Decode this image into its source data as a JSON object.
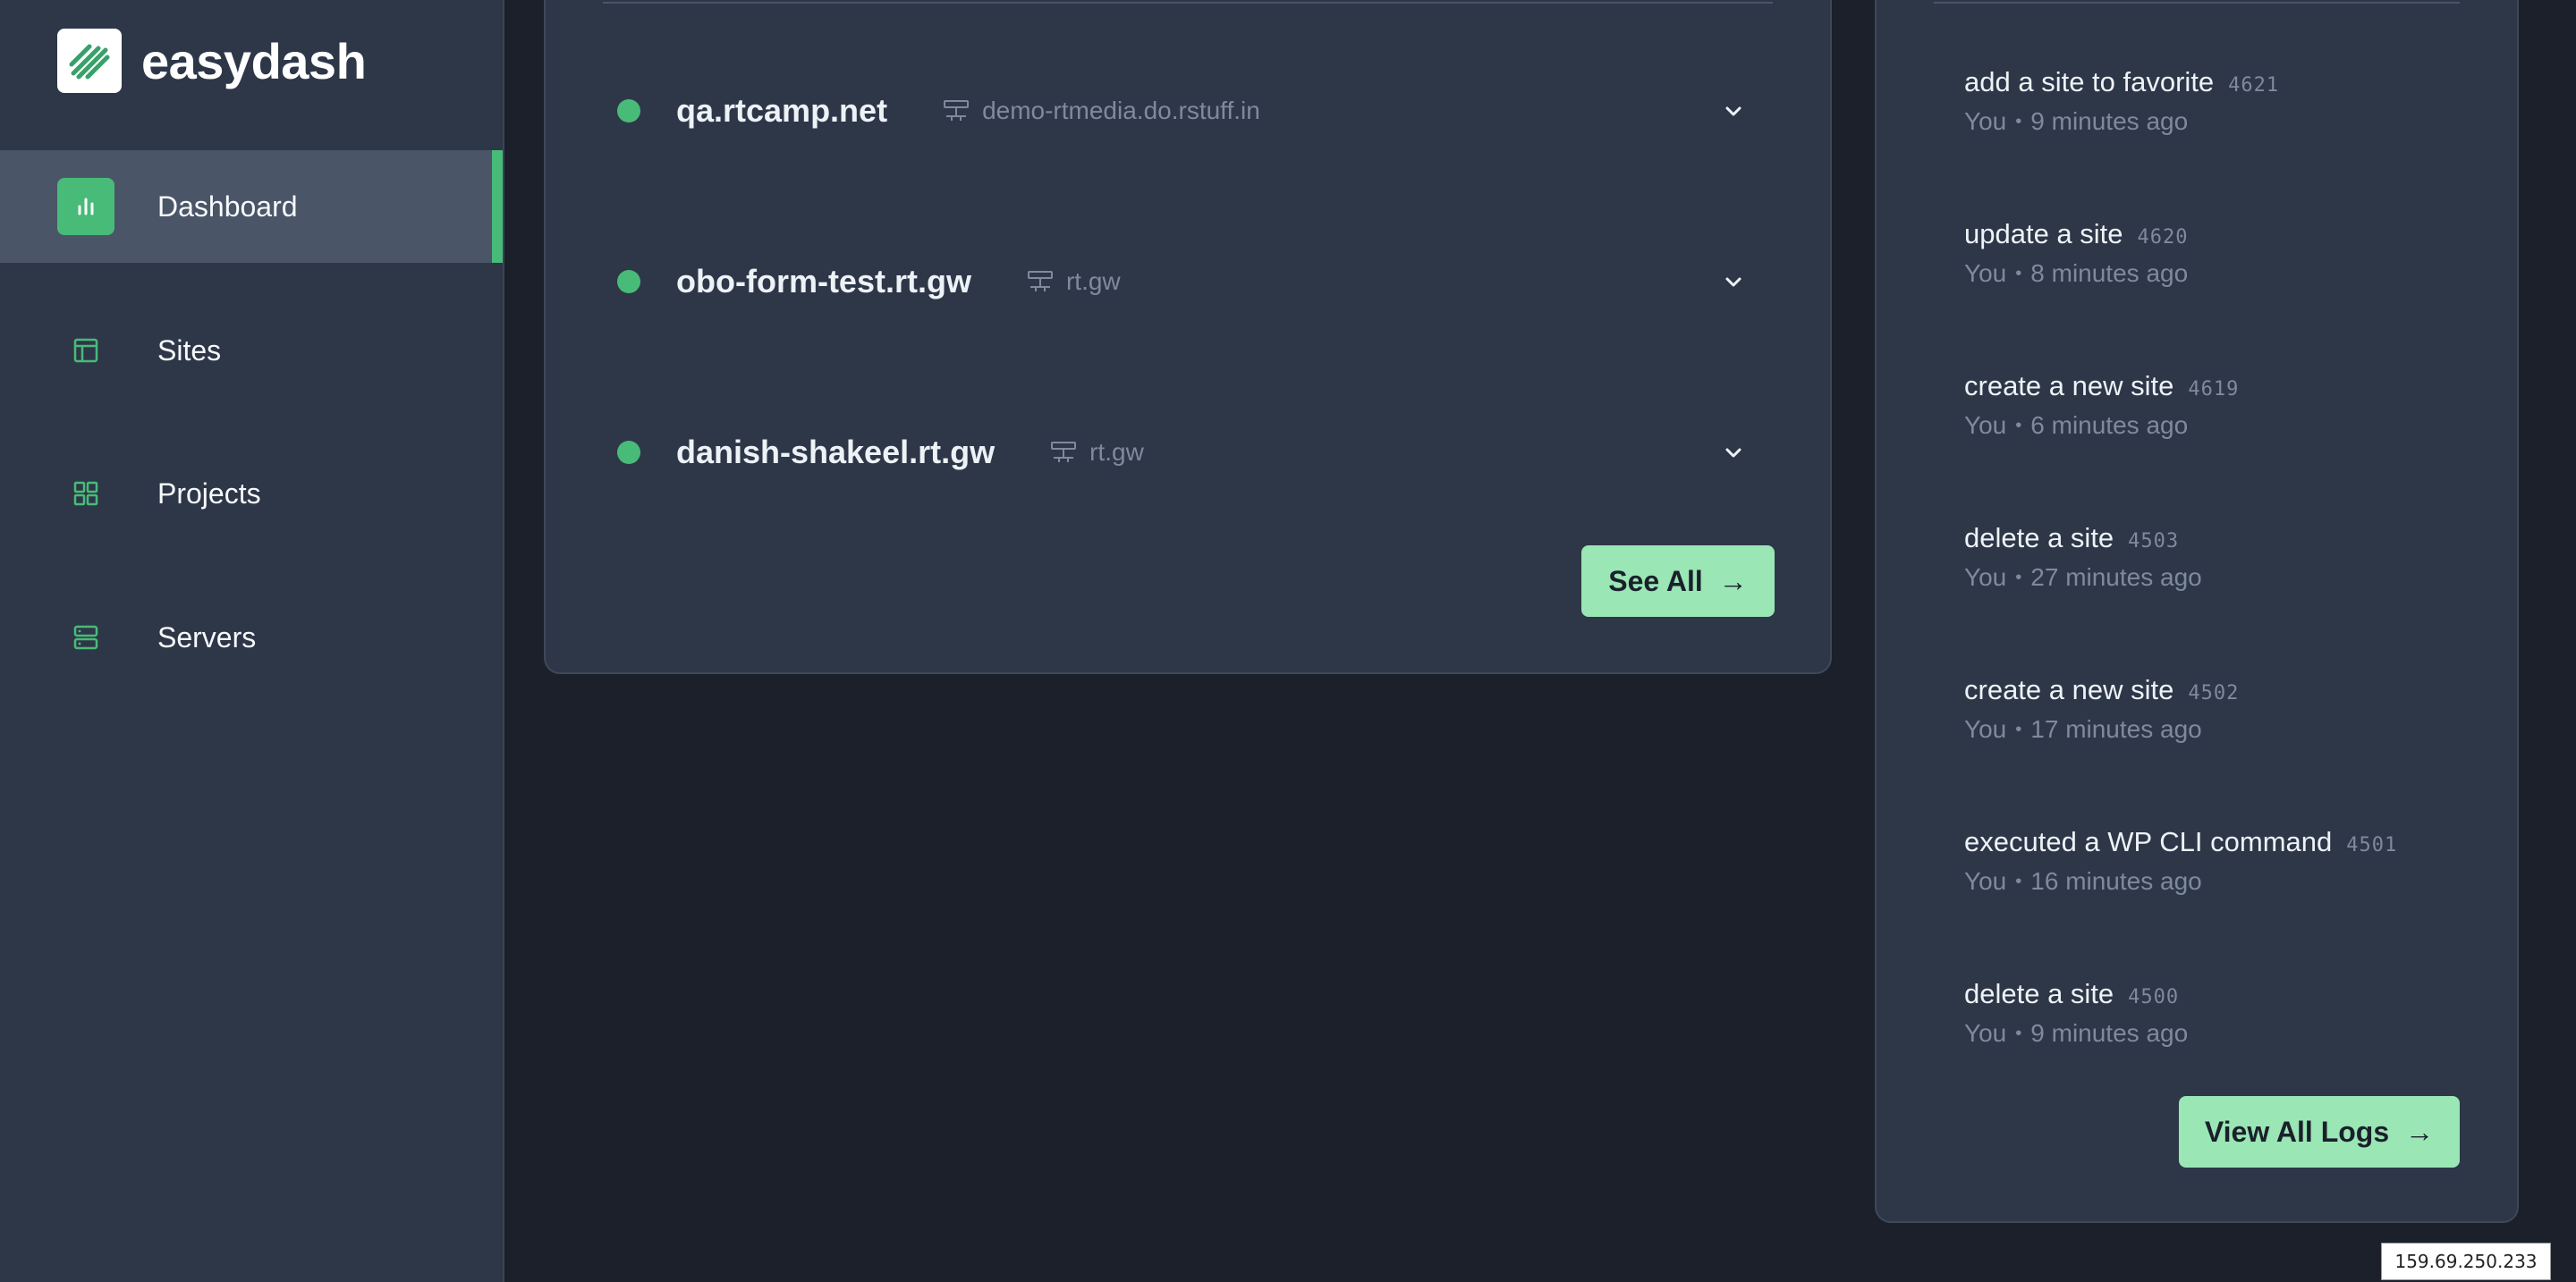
{
  "brand": {
    "name": "easydash"
  },
  "sidebar": {
    "items": [
      {
        "label": "Dashboard",
        "icon": "bar-chart-icon",
        "active": true
      },
      {
        "label": "Sites",
        "icon": "layout-icon",
        "active": false
      },
      {
        "label": "Projects",
        "icon": "grid-icon",
        "active": false
      },
      {
        "label": "Servers",
        "icon": "server-icon",
        "active": false
      }
    ]
  },
  "sites": {
    "rows": [
      {
        "name": "qa.rtcamp.net",
        "server": "demo-rtmedia.do.rstuff.in",
        "status": "online"
      },
      {
        "name": "obo-form-test.rt.gw",
        "server": "rt.gw",
        "status": "online"
      },
      {
        "name": "danish-shakeel.rt.gw",
        "server": "rt.gw",
        "status": "online"
      }
    ],
    "see_all_label": "See All",
    "see_all_arrow": "→"
  },
  "logs": {
    "items": [
      {
        "action": "add a site to favorite",
        "id": "4621",
        "user": "You",
        "time": "9 minutes ago"
      },
      {
        "action": "update a site",
        "id": "4620",
        "user": "You",
        "time": "8 minutes ago"
      },
      {
        "action": "create a new site",
        "id": "4619",
        "user": "You",
        "time": "6 minutes ago"
      },
      {
        "action": "delete a site",
        "id": "4503",
        "user": "You",
        "time": "27 minutes ago"
      },
      {
        "action": "create a new site",
        "id": "4502",
        "user": "You",
        "time": "17 minutes ago"
      },
      {
        "action": "executed a WP CLI command",
        "id": "4501",
        "user": "You",
        "time": "16 minutes ago"
      },
      {
        "action": "delete a site",
        "id": "4500",
        "user": "You",
        "time": "9 minutes ago"
      }
    ],
    "separator": "•",
    "view_all_label": "View All Logs",
    "view_all_arrow": "→"
  },
  "ip_label": "159.69.250.233",
  "colors": {
    "accent": "#48bb78",
    "button": "#9ae6b4",
    "sidebar_bg": "#2e3748",
    "page_bg": "#1b202b",
    "card_bg": "#2e3748",
    "muted_text": "#7e8a9d"
  }
}
